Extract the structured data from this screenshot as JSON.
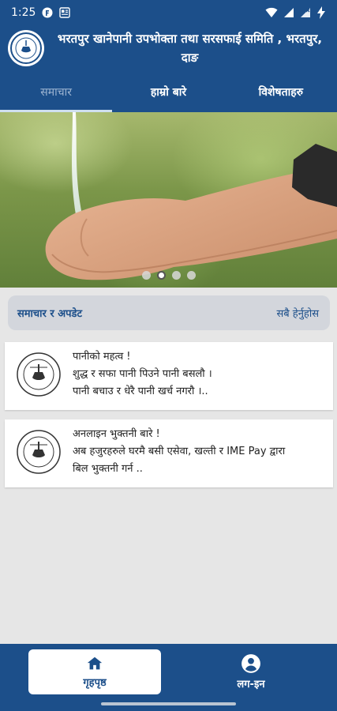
{
  "status": {
    "time": "1:25",
    "left_icons": [
      "f-badge-icon",
      "newspaper-icon"
    ],
    "right_icons": [
      "wifi-icon",
      "signal-icon",
      "signal-x-icon",
      "battery-charging-icon"
    ]
  },
  "header": {
    "title": "भरतपुर खानेपानी उपभोक्ता तथा सरसफाई समिति , भरतपुर, दाङ",
    "logo": "organization-seal-logo"
  },
  "tabs": [
    {
      "label": "समाचार",
      "active": true
    },
    {
      "label": "हाम्रो बारे",
      "active": false
    },
    {
      "label": "विशेषताहरु",
      "active": false
    }
  ],
  "carousel": {
    "image": "water-pouring-into-cupped-hands",
    "slides": 4,
    "active_index": 1
  },
  "news_section": {
    "title": "समाचार र अपडेट",
    "see_all": "सबै हेर्नुहोस"
  },
  "news": [
    {
      "title": "पानीको महत्व !",
      "line1": "शुद्ध र सफा पानी पिउने पानी बसलौ ।",
      "line2": "पानी बचाउ र धेरै पानी खर्च नगरौ ।.."
    },
    {
      "title": "अनलाइन भुक्तनी बारे !",
      "line1": "अब हजुरहरुले घरमै बसी एसेवा, खल्ती र IME Pay  द्वारा",
      "line2": " बिल भुक्तनी गर्न .."
    }
  ],
  "bottom_nav": {
    "home": {
      "label": "गृहपृष्ठ",
      "icon": "home-icon"
    },
    "login": {
      "label": "लग-इन",
      "icon": "account-circle-icon"
    }
  },
  "colors": {
    "primary": "#1c4f8a",
    "background": "#e6e6e6",
    "section_bar": "#d3d6dc"
  }
}
